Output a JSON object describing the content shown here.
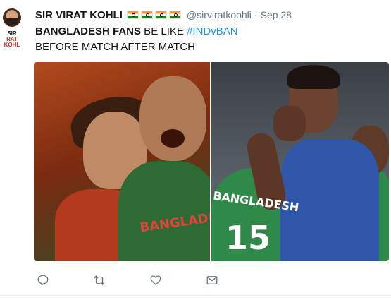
{
  "tweet": {
    "author_name": "SIR VIRAT KOHLI",
    "handle": "@sirviratkoohli",
    "separator": "·",
    "date": "Sep 28",
    "avatar": {
      "line1": "SIR",
      "line2": "RAT KOHL"
    },
    "flags": [
      "india-flag",
      "india-flag",
      "india-flag",
      "india-flag"
    ],
    "text_bold": "BANGLADESH FANS",
    "text_plain": " BE LIKE ",
    "hashtag": "#INDvBAN",
    "text_line2": "BEFORE MATCH  AFTER MATCH",
    "media": {
      "left_jersey_text": "BANGLADESH",
      "right_jersey_text": "BANGLADESH",
      "right_jersey_number": "15"
    },
    "actions": [
      {
        "icon": "reply-icon"
      },
      {
        "icon": "retweet-icon"
      },
      {
        "icon": "like-icon"
      },
      {
        "icon": "direct-message-icon"
      }
    ]
  },
  "colors": {
    "hashtag": "#1b95e0",
    "meta_text": "#657786",
    "icon": "#657786"
  }
}
